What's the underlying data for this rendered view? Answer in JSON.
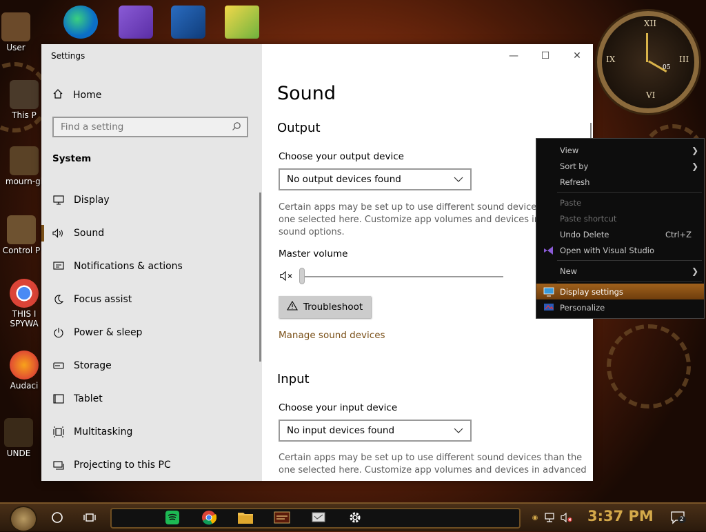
{
  "window": {
    "title": "Settings",
    "minimize_glyph": "—",
    "maximize_glyph": "☐",
    "close_glyph": "✕"
  },
  "sidebar": {
    "home_label": "Home",
    "search_placeholder": "Find a setting",
    "section_label": "System",
    "items": [
      {
        "label": "Display",
        "icon": "monitor-icon"
      },
      {
        "label": "Sound",
        "icon": "speaker-icon",
        "active": true
      },
      {
        "label": "Notifications & actions",
        "icon": "notification-icon"
      },
      {
        "label": "Focus assist",
        "icon": "moon-icon"
      },
      {
        "label": "Power & sleep",
        "icon": "power-icon"
      },
      {
        "label": "Storage",
        "icon": "storage-icon"
      },
      {
        "label": "Tablet",
        "icon": "tablet-icon"
      },
      {
        "label": "Multitasking",
        "icon": "multitasking-icon"
      },
      {
        "label": "Projecting to this PC",
        "icon": "projector-icon"
      }
    ]
  },
  "main": {
    "page_title": "Sound",
    "output": {
      "heading": "Output",
      "device_label": "Choose your output device",
      "device_value": "No output devices found",
      "description_line1": "Certain apps may be set up to use different sound devices th",
      "description_line2": "one selected here. Customize app volumes and devices in ad",
      "description_line3": "sound options.",
      "volume_label": "Master volume",
      "volume_level": 0,
      "troubleshoot_label": "Troubleshoot",
      "manage_link": "Manage sound devices"
    },
    "input": {
      "heading": "Input",
      "device_label": "Choose your input device",
      "device_value": "No input devices found",
      "description_line1": "Certain apps may be set up to use different sound devices than the",
      "description_line2": "one selected here. Customize app volumes and devices in advanced"
    }
  },
  "context_menu": {
    "items": [
      {
        "label": "View",
        "submenu": true
      },
      {
        "label": "Sort by",
        "submenu": true
      },
      {
        "label": "Refresh"
      },
      {
        "label": "Paste",
        "disabled": true
      },
      {
        "label": "Paste shortcut",
        "disabled": true
      },
      {
        "label": "Undo Delete",
        "shortcut": "Ctrl+Z"
      },
      {
        "label": "Open with Visual Studio",
        "icon": "visual-studio-icon"
      },
      {
        "label": "New",
        "submenu": true
      },
      {
        "label": "Display settings",
        "icon": "display-settings-icon",
        "highlighted": true
      },
      {
        "label": "Personalize",
        "icon": "personalize-icon"
      }
    ]
  },
  "desktop": {
    "icons": [
      "User",
      "This P",
      "mourn-gi",
      "Control P",
      "THIS I SPYWA",
      "Audaci",
      "UNDE"
    ]
  },
  "taskbar": {
    "time": "3:37 PM",
    "notification_count": "2"
  },
  "colors": {
    "accent": "#7a5018",
    "sidebar_bg": "#e6e6e6",
    "menu_highlight": "#a0611c",
    "clock_text": "#d4a94a"
  }
}
